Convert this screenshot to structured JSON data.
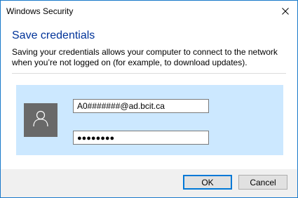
{
  "window": {
    "title": "Windows Security"
  },
  "dialog": {
    "heading": "Save credentials",
    "description": "Saving your credentials allows your computer to connect to the network when you’re not logged on (for example, to download updates)."
  },
  "credentials": {
    "username": "A0#######@ad.bcit.ca",
    "password_mask": "●●●●●●●●"
  },
  "buttons": {
    "ok_label": "OK",
    "cancel_label": "Cancel"
  },
  "icons": {
    "close": "close-icon",
    "avatar": "user-icon"
  },
  "colors": {
    "heading": "#003399",
    "panel": "#cce8ff",
    "avatar_bg": "#696969",
    "default_button_border": "#0078d7"
  }
}
